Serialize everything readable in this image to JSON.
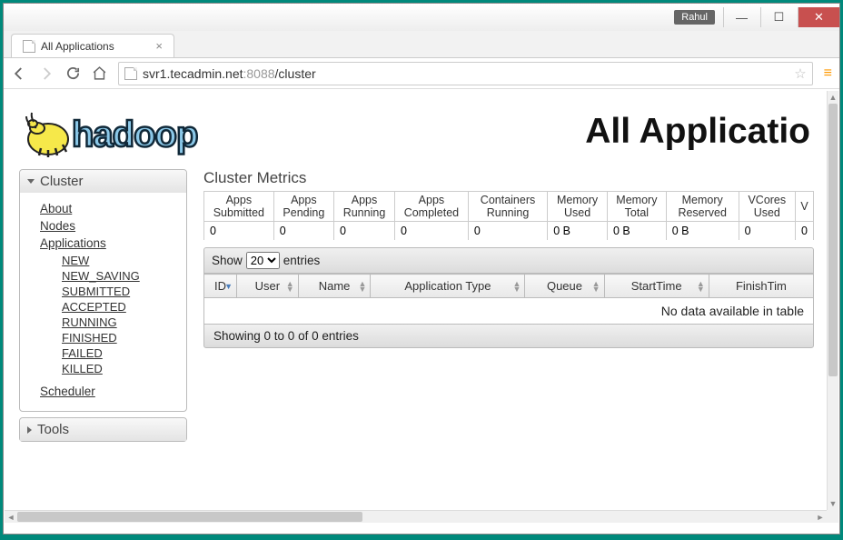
{
  "window": {
    "user_badge": "Rahul",
    "tab_title": "All Applications",
    "url_host": "svr1.tecadmin.net",
    "url_port": ":8088",
    "url_path": "/cluster"
  },
  "header": {
    "logo_text": "hadoop",
    "page_title": "All Applicatio"
  },
  "sidebar": {
    "cluster": {
      "title": "Cluster",
      "links": {
        "about": "About",
        "nodes": "Nodes",
        "applications": "Applications",
        "scheduler": "Scheduler"
      },
      "app_states": {
        "new": "NEW",
        "new_saving": "NEW_SAVING",
        "submitted": "SUBMITTED",
        "accepted": "ACCEPTED",
        "running": "RUNNING",
        "finished": "FINISHED",
        "failed": "FAILED",
        "killed": "KILLED"
      }
    },
    "tools": {
      "title": "Tools"
    }
  },
  "main": {
    "metrics": {
      "title": "Cluster Metrics",
      "headers": {
        "apps_submitted": "Apps Submitted",
        "apps_pending": "Apps Pending",
        "apps_running": "Apps Running",
        "apps_completed": "Apps Completed",
        "containers_running": "Containers Running",
        "memory_used": "Memory Used",
        "memory_total": "Memory Total",
        "memory_reserved": "Memory Reserved",
        "vcores_used": "VCores Used",
        "vcores_partial": "V"
      },
      "values": {
        "apps_submitted": "0",
        "apps_pending": "0",
        "apps_running": "0",
        "apps_completed": "0",
        "containers_running": "0",
        "memory_used": "0 B",
        "memory_total": "0 B",
        "memory_reserved": "0 B",
        "vcores_used": "0",
        "vcores_partial": "0"
      }
    },
    "controls": {
      "show_label": "Show",
      "entries_label": "entries",
      "page_size": "20"
    },
    "columns": {
      "id": "ID",
      "user": "User",
      "name": "Name",
      "app_type": "Application Type",
      "queue": "Queue",
      "start_time": "StartTime",
      "finish_time": "FinishTim"
    },
    "no_data": "No data available in table",
    "footer": "Showing 0 to 0 of 0 entries"
  }
}
